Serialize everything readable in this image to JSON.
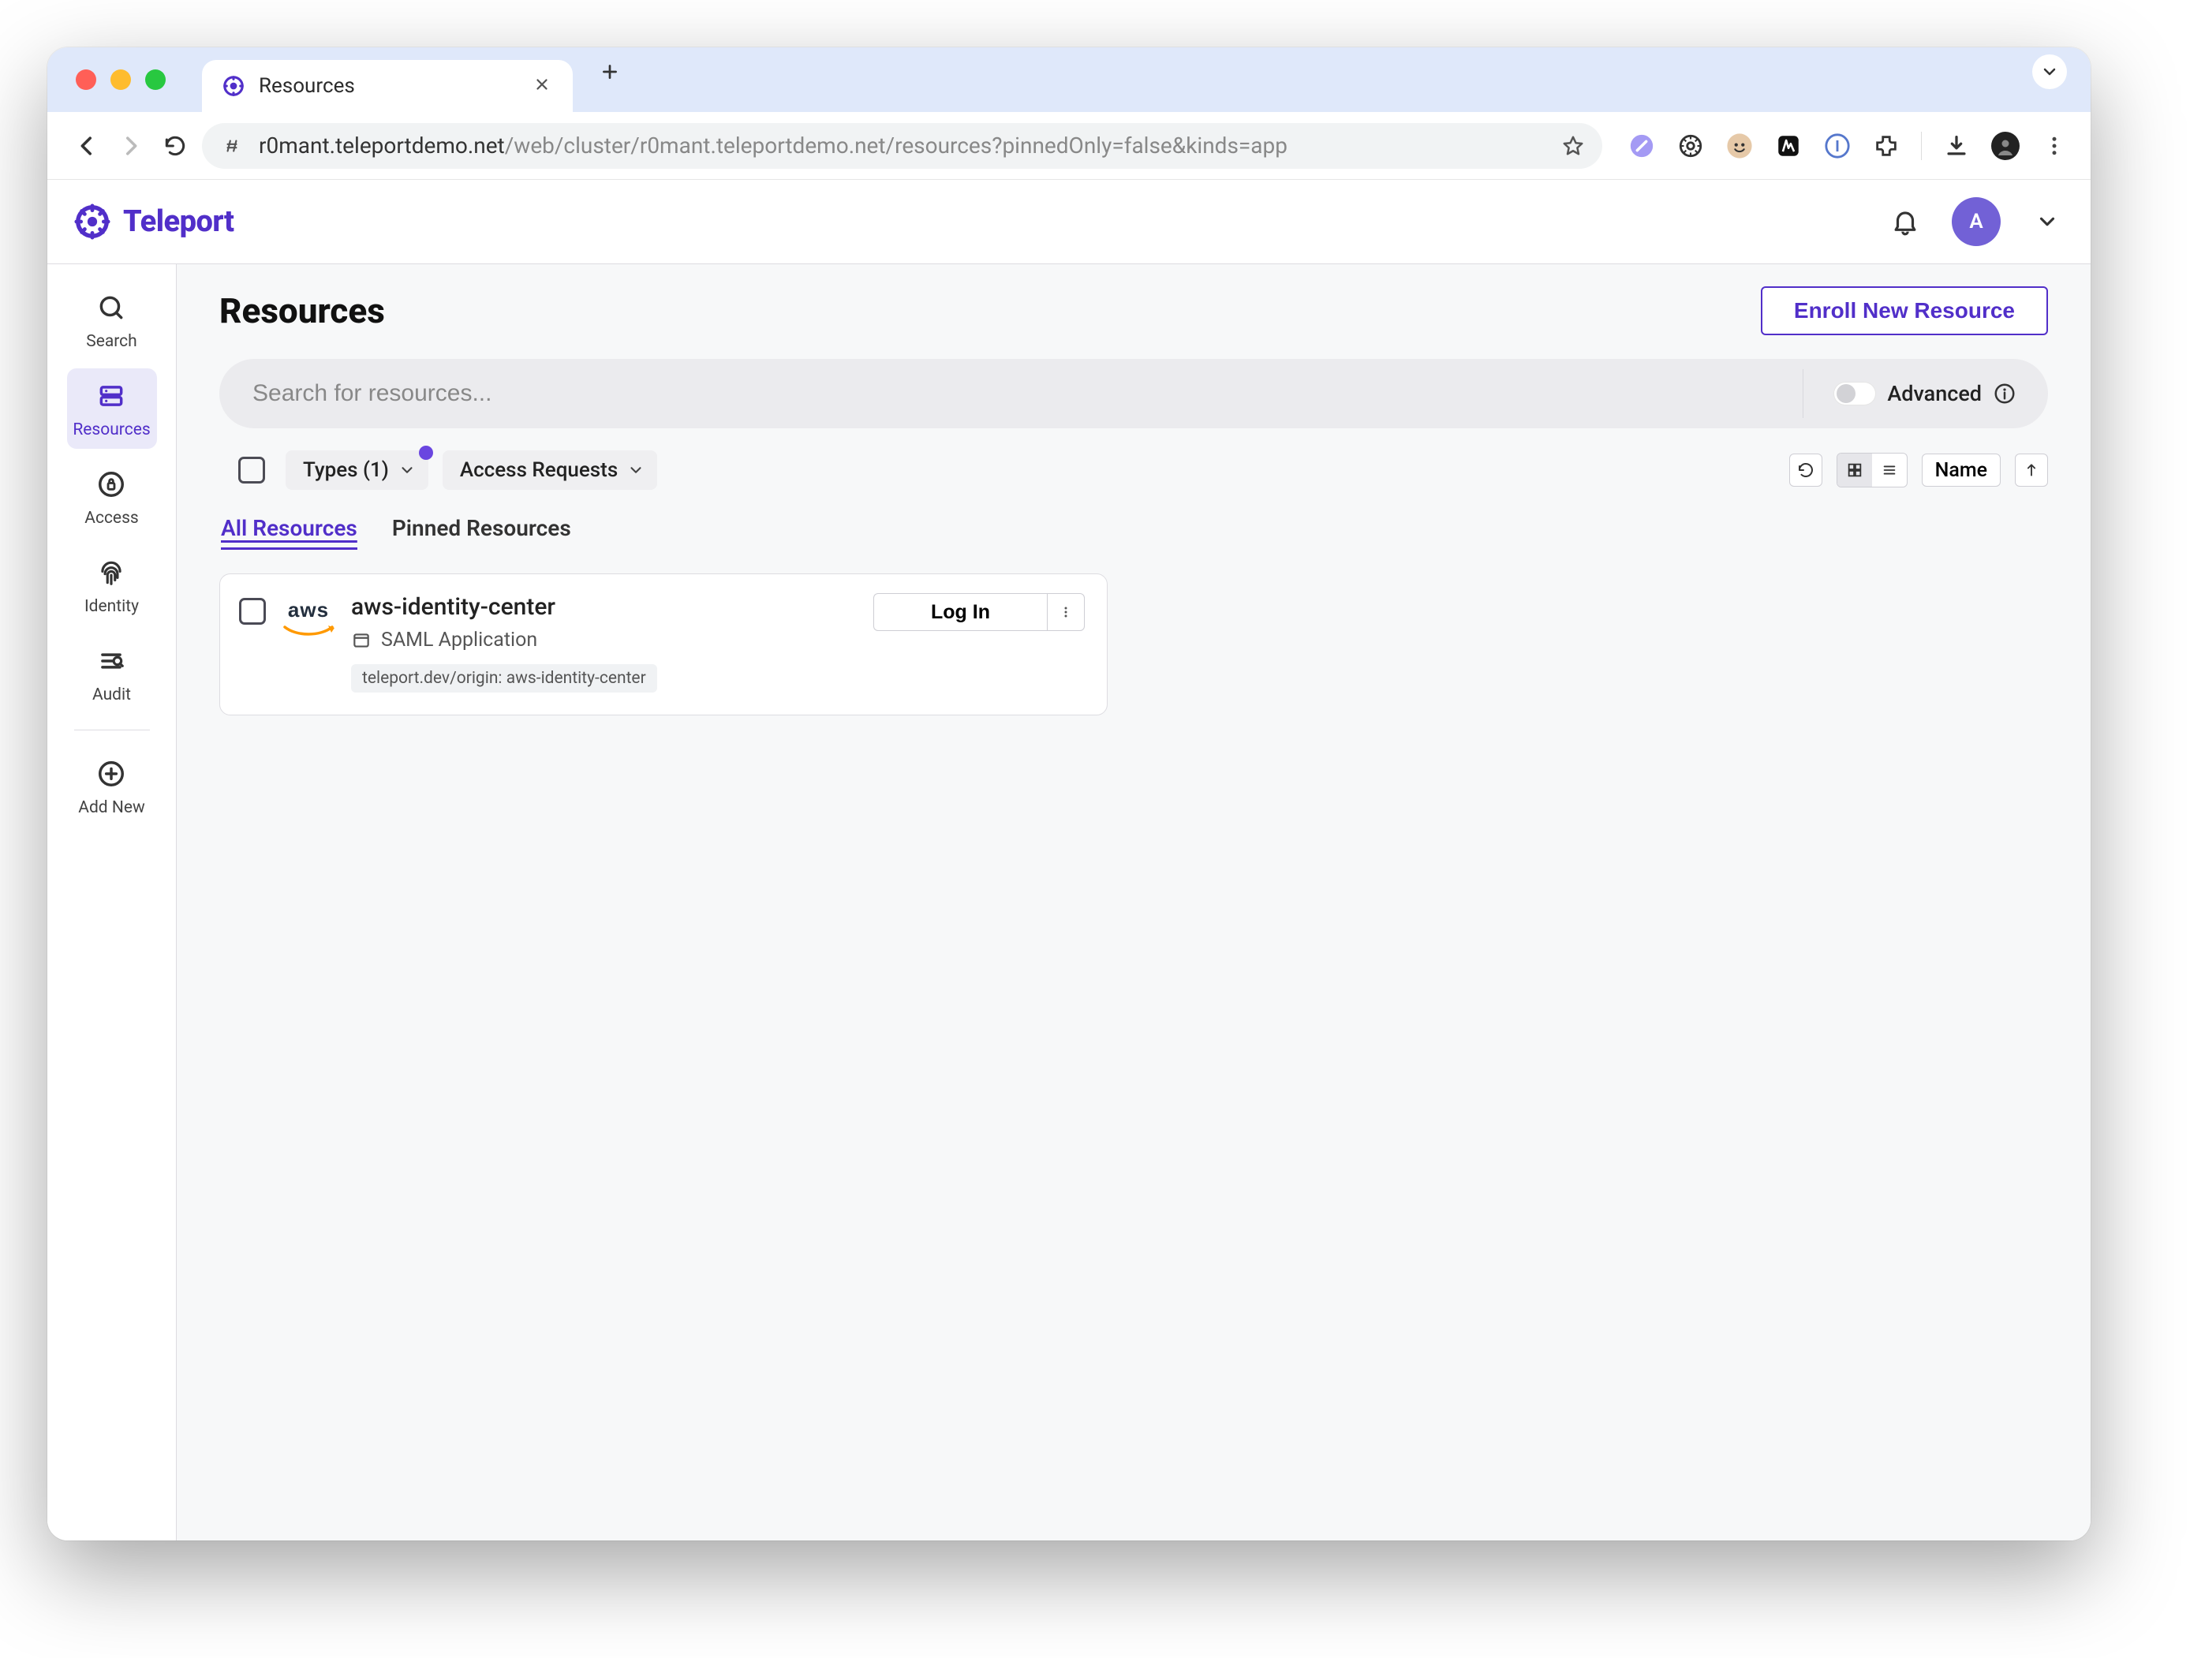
{
  "browser": {
    "tab_title": "Resources",
    "url_host": "r0mant.teleportdemo.net",
    "url_path": "/web/cluster/r0mant.teleportdemo.net/resources?pinnedOnly=false&kinds=app"
  },
  "header": {
    "brand": "Teleport",
    "user_initial": "A"
  },
  "sidebar": {
    "items": [
      {
        "label": "Search"
      },
      {
        "label": "Resources"
      },
      {
        "label": "Access"
      },
      {
        "label": "Identity"
      },
      {
        "label": "Audit"
      },
      {
        "label": "Add New"
      }
    ]
  },
  "page": {
    "title": "Resources",
    "enroll_button": "Enroll New Resource",
    "search_placeholder": "Search for resources...",
    "advanced_label": "Advanced"
  },
  "filters": {
    "types_label": "Types (1)",
    "access_requests_label": "Access Requests",
    "sort_label": "Name"
  },
  "tabs": {
    "all": "All Resources",
    "pinned": "Pinned Resources"
  },
  "resources": [
    {
      "name": "aws-identity-center",
      "kind": "SAML Application",
      "tag": "teleport.dev/origin: aws-identity-center",
      "action_label": "Log In"
    }
  ]
}
